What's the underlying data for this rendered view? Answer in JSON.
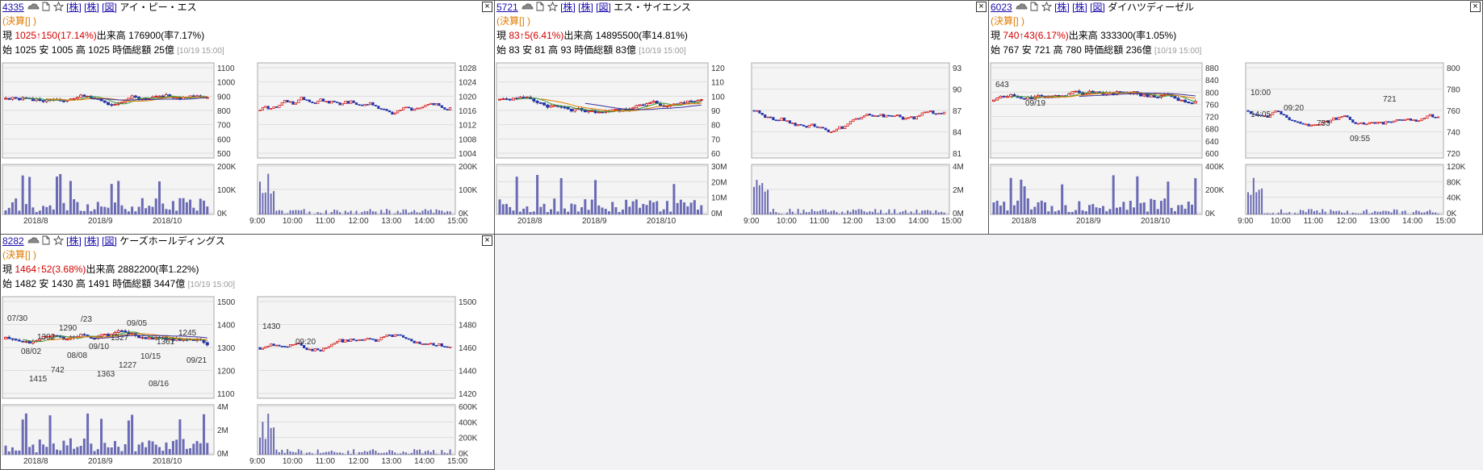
{
  "ui": {
    "up_arrow": "↑",
    "close_glyph": "×",
    "bracket_open": "[",
    "bracket_close": "]"
  },
  "colors": {
    "price_up": "#d00000",
    "link": "#1a0dab",
    "kessan": "#e07b00",
    "volume": "#6b6bb5",
    "ma_long": "#3a2f9a",
    "ma_mid": "#e07b00",
    "ma_short": "#3a9a3a"
  },
  "panels": [
    {
      "code": "4335",
      "name": "アイ・ピー・エス",
      "links": [
        "株",
        "株",
        "図"
      ],
      "kessan": "(決算[] )",
      "now_label": "現",
      "price": "1025",
      "change": "↑150(17.14%)",
      "volume_label": "出来高",
      "volume": "176900(率7.17%)",
      "open_label": "始",
      "open": "1025",
      "low_label": "安",
      "low": "1005",
      "high_label": "高",
      "high": "1025",
      "mcap_label": "時価総額",
      "mcap": "25億",
      "time": "[10/19 15:00]",
      "daily_price_ticks": [
        "1100",
        "1000",
        "900",
        "800",
        "700",
        "600",
        "500"
      ],
      "daily_vol_ticks": [
        "200K",
        "100K",
        "0K"
      ],
      "daily_x_ticks": [
        "2018/8",
        "2018/9",
        "2018/10"
      ],
      "intra_price_ticks": [
        "1028",
        "1024",
        "1020",
        "1016",
        "1012",
        "1008",
        "1004"
      ],
      "intra_vol_ticks": [
        "200K",
        "100K",
        "0K"
      ],
      "intra_x_ticks": [
        "9:00",
        "10:00",
        "11:00",
        "12:00",
        "13:00",
        "14:00",
        "15:00"
      ],
      "daily_annotations": [],
      "intra_annotations": []
    },
    {
      "code": "5721",
      "name": "エス・サイエンス",
      "links": [
        "株",
        "株",
        "図"
      ],
      "kessan": "(決算[] )",
      "now_label": "現",
      "price": "83",
      "change": "↑5(6.41%)",
      "volume_label": "出来高",
      "volume": "14895500(率14.81%)",
      "open_label": "始",
      "open": "83",
      "low_label": "安",
      "low": "81",
      "high_label": "高",
      "high": "93",
      "mcap_label": "時価総額",
      "mcap": "83億",
      "time": "[10/19 15:00]",
      "daily_price_ticks": [
        "120",
        "110",
        "100",
        "90",
        "80",
        "70",
        "60"
      ],
      "daily_vol_ticks": [
        "30M",
        "20M",
        "10M",
        "0M"
      ],
      "daily_x_ticks": [
        "2018/8",
        "2018/9",
        "2018/10"
      ],
      "intra_price_ticks": [
        "93",
        "90",
        "87",
        "84",
        "81"
      ],
      "intra_vol_ticks": [
        "4M",
        "2M",
        "0M"
      ],
      "intra_x_ticks": [
        "9:00",
        "10:00",
        "11:00",
        "12:00",
        "13:00",
        "14:00",
        "15:00"
      ],
      "daily_annotations": [],
      "intra_annotations": []
    },
    {
      "code": "6023",
      "name": "ダイハツディーゼル",
      "links": [
        "株",
        "株",
        "図"
      ],
      "kessan": "(決算[] )",
      "now_label": "現",
      "price": "740",
      "change": "↑43(6.17%)",
      "volume_label": "出来高",
      "volume": "333300(率1.05%)",
      "open_label": "始",
      "open": "767",
      "low_label": "安",
      "low": "721",
      "high_label": "高",
      "high": "780",
      "mcap_label": "時価総額",
      "mcap": "236億",
      "time": "[10/19 15:00]",
      "daily_price_ticks": [
        "880",
        "840",
        "800",
        "760",
        "720",
        "680",
        "640",
        "600"
      ],
      "daily_vol_ticks": [
        "400K",
        "200K",
        "0K"
      ],
      "daily_x_ticks": [
        "2018/8",
        "2018/9",
        "2018/10"
      ],
      "intra_price_ticks": [
        "800",
        "780",
        "760",
        "740",
        "720"
      ],
      "intra_vol_ticks": [
        "120K",
        "80K",
        "40K",
        "0K"
      ],
      "intra_x_ticks": [
        "9:00",
        "10:00",
        "11:00",
        "12:00",
        "13:00",
        "14:00",
        "15:00"
      ],
      "daily_annotations": [
        "643",
        "09/19"
      ],
      "intra_annotations": [
        "10:00",
        "09:20",
        "753",
        "09:55",
        "721",
        "14:05"
      ]
    },
    {
      "code": "8282",
      "name": "ケーズホールディングス",
      "links": [
        "株",
        "株",
        "図"
      ],
      "kessan": "(決算[] )",
      "now_label": "現",
      "price": "1464",
      "change": "↑52(3.68%)",
      "volume_label": "出来高",
      "volume": "2882200(率1.22%)",
      "open_label": "始",
      "open": "1482",
      "low_label": "安",
      "low": "1430",
      "high_label": "高",
      "high": "1491",
      "mcap_label": "時価総額",
      "mcap": "3447億",
      "time": "[10/19 15:00]",
      "daily_price_ticks": [
        "1500",
        "1400",
        "1300",
        "1200",
        "1100"
      ],
      "daily_vol_ticks": [
        "4M",
        "2M",
        "0M"
      ],
      "daily_x_ticks": [
        "2018/8",
        "2018/9",
        "2018/10"
      ],
      "intra_price_ticks": [
        "1500",
        "1480",
        "1460",
        "1440",
        "1420"
      ],
      "intra_vol_ticks": [
        "600K",
        "400K",
        "200K",
        "0K"
      ],
      "intra_x_ticks": [
        "9:00",
        "10:00",
        "11:00",
        "12:00",
        "13:00",
        "14:00",
        "15:00"
      ],
      "daily_annotations": [
        "07/30",
        "1302",
        "08/08",
        "1363",
        "09/05",
        "1361",
        "09/21",
        "1415",
        "1290",
        "09/10",
        "1227",
        "08/16",
        "1245",
        "08/02",
        "742",
        "/23",
        "1327",
        "10/15"
      ],
      "intra_annotations": [
        "1430",
        "09:20"
      ]
    }
  ]
}
